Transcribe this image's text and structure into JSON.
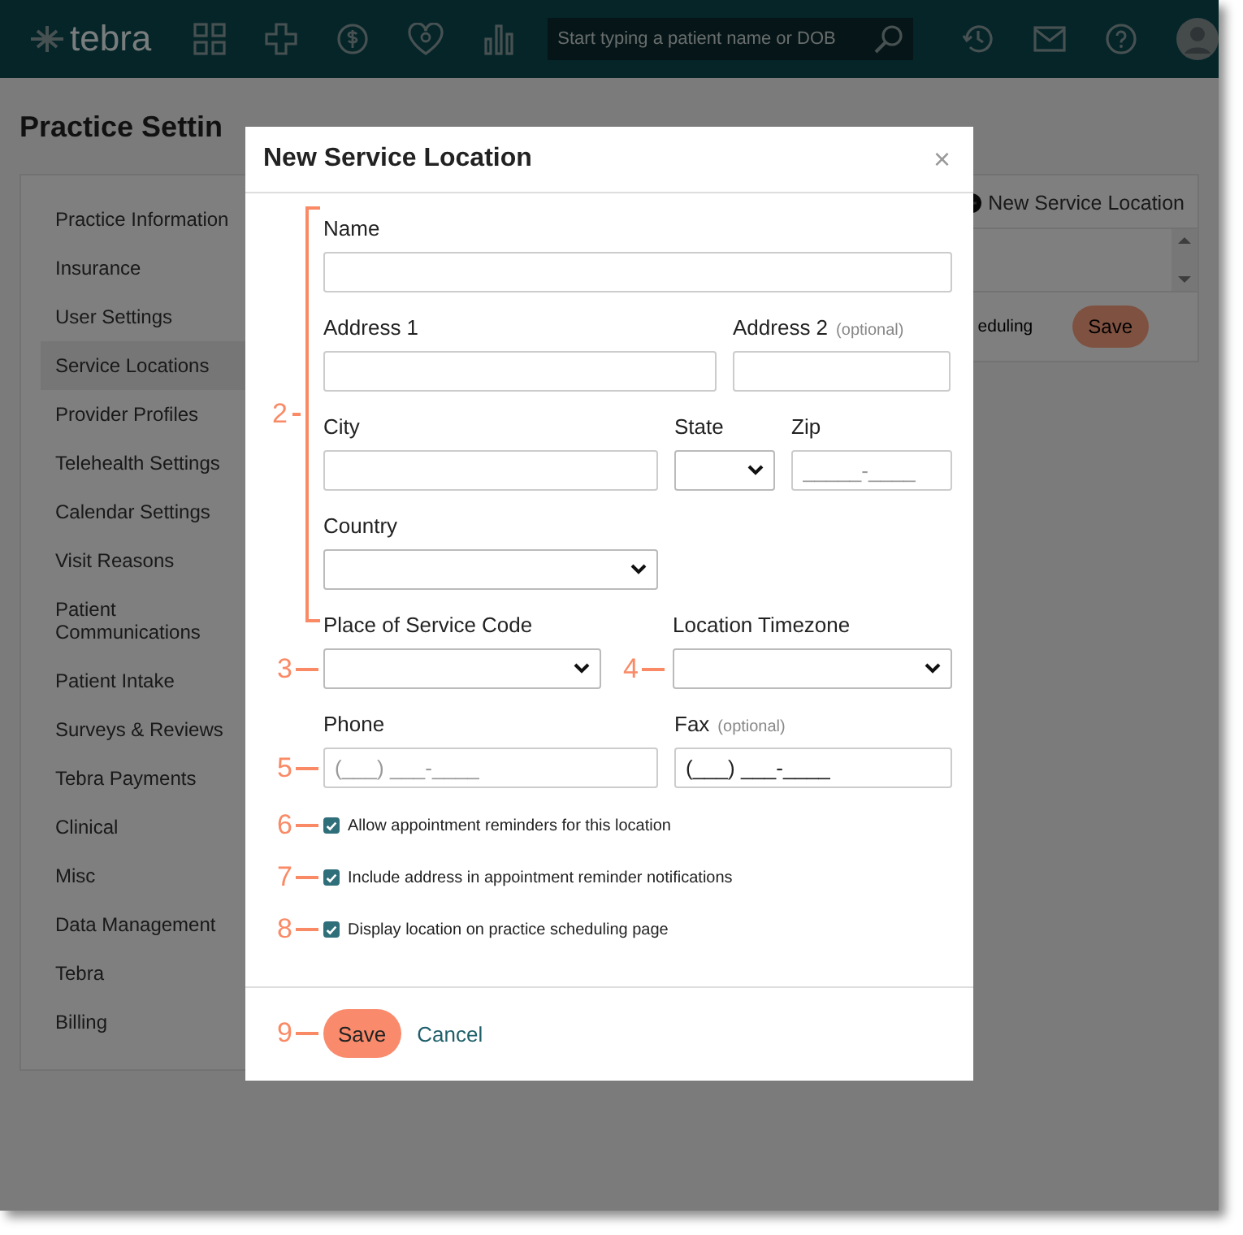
{
  "topbar": {
    "logo": "tebra",
    "search": {
      "placeholder": "Start typing a patient name or DOB"
    }
  },
  "page": {
    "title": "Practice Settin"
  },
  "sidebar": {
    "items": [
      {
        "label": "Practice Information",
        "selected": false
      },
      {
        "label": "Insurance",
        "selected": false
      },
      {
        "label": "User Settings",
        "selected": false
      },
      {
        "label": "Service Locations",
        "selected": true
      },
      {
        "label": "Provider Profiles",
        "selected": false
      },
      {
        "label": "Telehealth Settings",
        "selected": false
      },
      {
        "label": "Calendar Settings",
        "selected": false
      },
      {
        "label": "Visit Reasons",
        "selected": false
      },
      {
        "label": "Patient Communications",
        "selected": false
      },
      {
        "label": "Patient Intake",
        "selected": false
      },
      {
        "label": "Surveys & Reviews",
        "selected": false
      },
      {
        "label": "Tebra Payments",
        "selected": false
      },
      {
        "label": "Clinical",
        "selected": false
      },
      {
        "label": "Misc",
        "selected": false
      },
      {
        "label": "Data Management",
        "selected": false
      },
      {
        "label": "Tebra",
        "selected": false
      },
      {
        "label": "Billing",
        "selected": false
      }
    ]
  },
  "panel": {
    "new_button": "New Service Location",
    "row_text": "eduling",
    "save_button": "Save"
  },
  "dialog": {
    "title": "New Service Location",
    "close": "×",
    "group": {
      "callout": "2",
      "rows": [
        {
          "fields": [
            {
              "label": "Name",
              "kind": "text"
            }
          ]
        },
        {
          "fields": [
            {
              "label": "Address 1",
              "kind": "text"
            },
            {
              "label": "Address 2",
              "note": "(optional)",
              "kind": "text"
            }
          ]
        },
        {
          "fields": [
            {
              "label": "City",
              "kind": "text"
            },
            {
              "label": "State",
              "kind": "select"
            },
            {
              "label": "Zip",
              "kind": "text",
              "placeholder": "_____-____"
            }
          ]
        },
        {
          "fields": [
            {
              "label": "Country",
              "kind": "select"
            }
          ]
        }
      ]
    },
    "rows": [
      {
        "callout": "3",
        "fields": [
          {
            "label": "Place of Service Code",
            "kind": "select"
          },
          {
            "label": "Location Timezone",
            "kind": "select",
            "callout": "4"
          }
        ]
      },
      {
        "callout": "5",
        "fields": [
          {
            "label": "Phone",
            "kind": "text",
            "placeholder": "(___) ___-____"
          },
          {
            "label": "Fax",
            "note": "(optional)",
            "kind": "text",
            "value": "(___) ___-____"
          }
        ]
      }
    ],
    "checkboxes": [
      {
        "callout": "6",
        "label": "Allow appointment reminders for this location",
        "checked": true
      },
      {
        "callout": "7",
        "label": "Include address in appointment reminder notifications",
        "checked": true
      },
      {
        "callout": "8",
        "label": "Display location on practice scheduling page",
        "checked": true
      }
    ],
    "footer": {
      "callout": "9",
      "save": "Save",
      "cancel": "Cancel"
    }
  }
}
